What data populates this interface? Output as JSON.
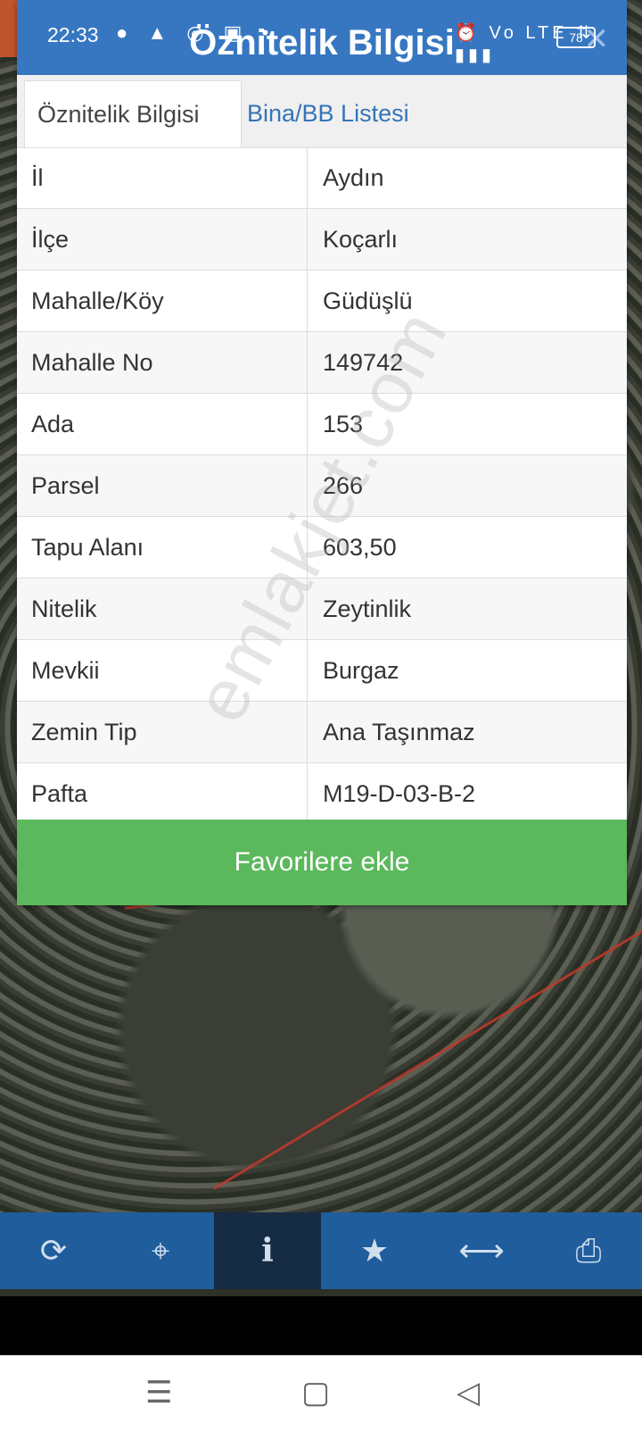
{
  "status_bar": {
    "time": "22:33",
    "left_icons": "● ▲ ◎ ▣ •",
    "right_icons": "⏰ Vo LTE ⇅ ▮▮▮",
    "battery": "78"
  },
  "dialog": {
    "title": "Öznitelik Bilgisi",
    "close_icon": "✕",
    "tabs": [
      {
        "label": "Öznitelik Bilgisi",
        "active": true
      },
      {
        "label": "Bina/BB Listesi",
        "active": false
      }
    ],
    "rows": [
      {
        "key": "İl",
        "value": "Aydın"
      },
      {
        "key": "İlçe",
        "value": "Koçarlı"
      },
      {
        "key": "Mahalle/Köy",
        "value": "Güdüşlü"
      },
      {
        "key": "Mahalle No",
        "value": "149742"
      },
      {
        "key": "Ada",
        "value": "153"
      },
      {
        "key": "Parsel",
        "value": "266"
      },
      {
        "key": "Tapu Alanı",
        "value": "603,50"
      },
      {
        "key": "Nitelik",
        "value": "Zeytinlik"
      },
      {
        "key": "Mevkii",
        "value": "Burgaz"
      },
      {
        "key": "Zemin Tip",
        "value": "Ana Taşınmaz"
      },
      {
        "key": "Pafta",
        "value": "M19-D-03-B-2"
      }
    ],
    "favorite_button": "Favorilere ekle"
  },
  "watermark": "emlakjet.com",
  "toolbar": {
    "buttons": [
      {
        "icon": "refresh-icon",
        "glyph": "⟳"
      },
      {
        "icon": "locate-icon",
        "glyph": "⌖"
      },
      {
        "icon": "info-icon",
        "glyph": "i",
        "active": true
      },
      {
        "icon": "star-icon",
        "glyph": "★"
      },
      {
        "icon": "measure-icon",
        "glyph": "⟷"
      },
      {
        "icon": "print-icon",
        "glyph": "⎙"
      }
    ]
  },
  "nav": {
    "menu_glyph": "☰",
    "home_glyph": "▢",
    "back_glyph": "◁"
  }
}
